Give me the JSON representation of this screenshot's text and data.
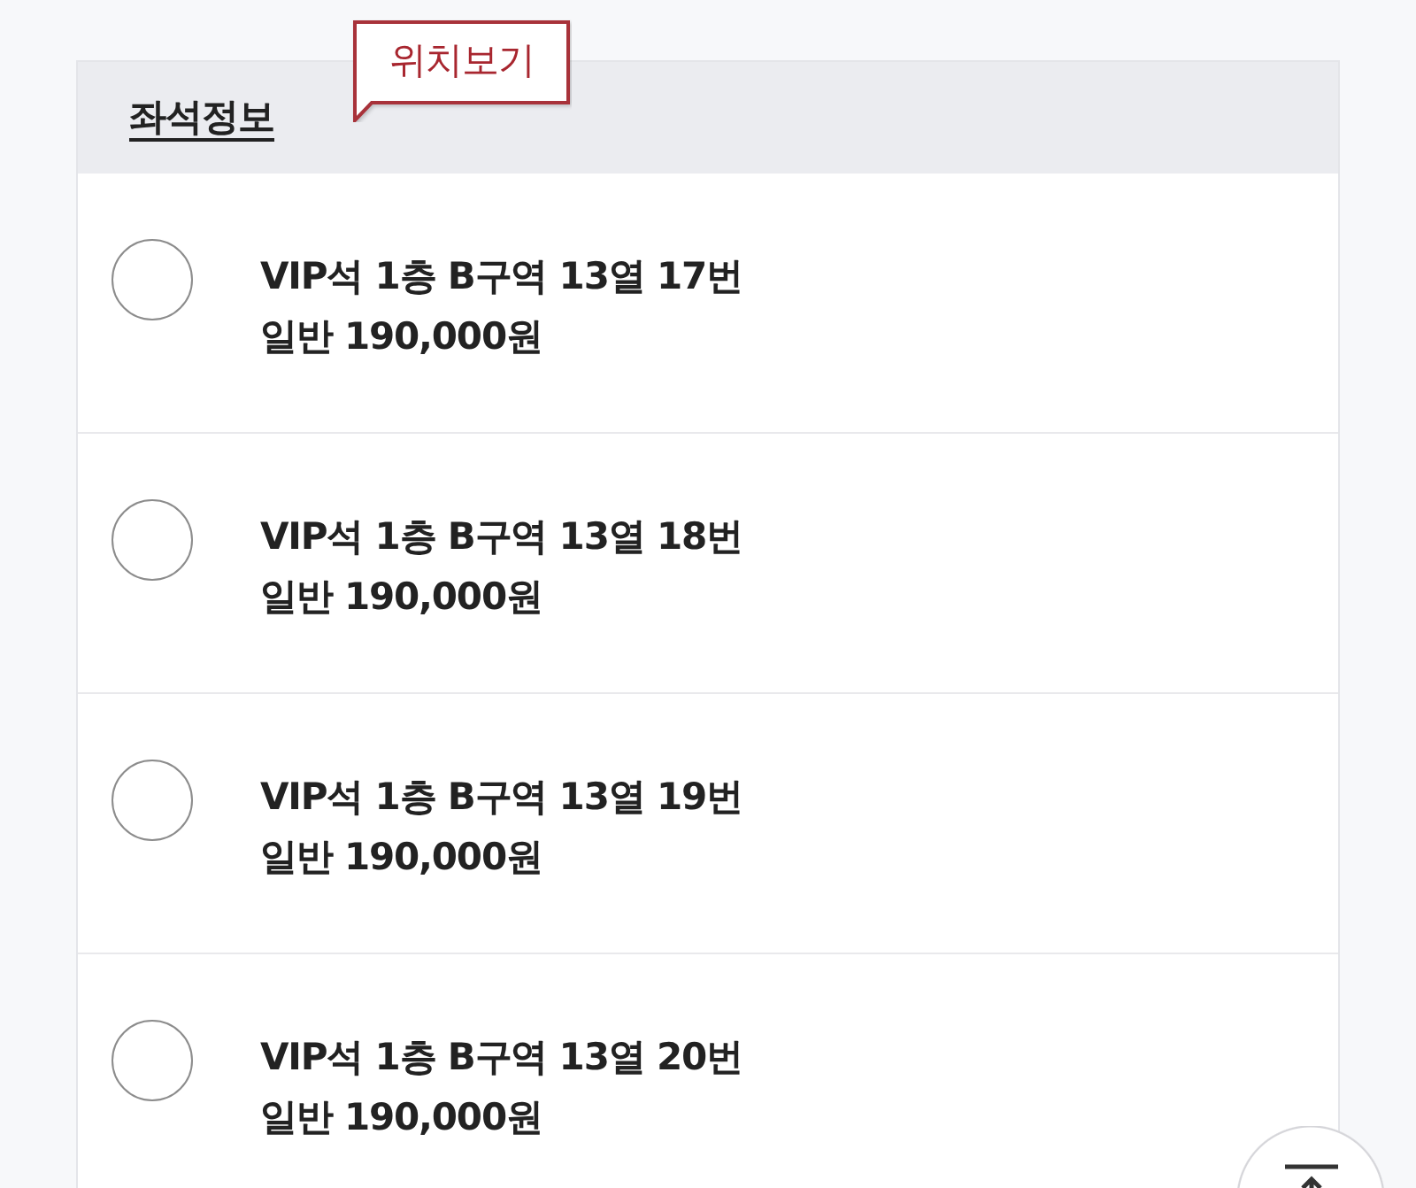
{
  "section": {
    "title": "좌석정보",
    "location_link": "위치보기"
  },
  "seats": [
    {
      "seat": "VIP석 1층 B구역 13열 17번",
      "price": "일반 190,000원",
      "selected": false
    },
    {
      "seat": "VIP석 1층 B구역 13열 18번",
      "price": "일반 190,000원",
      "selected": false
    },
    {
      "seat": "VIP석 1층 B구역 13열 19번",
      "price": "일반 190,000원",
      "selected": false
    },
    {
      "seat": "VIP석 1층 B구역 13열 20번",
      "price": "일반 190,000원",
      "selected": false
    }
  ]
}
